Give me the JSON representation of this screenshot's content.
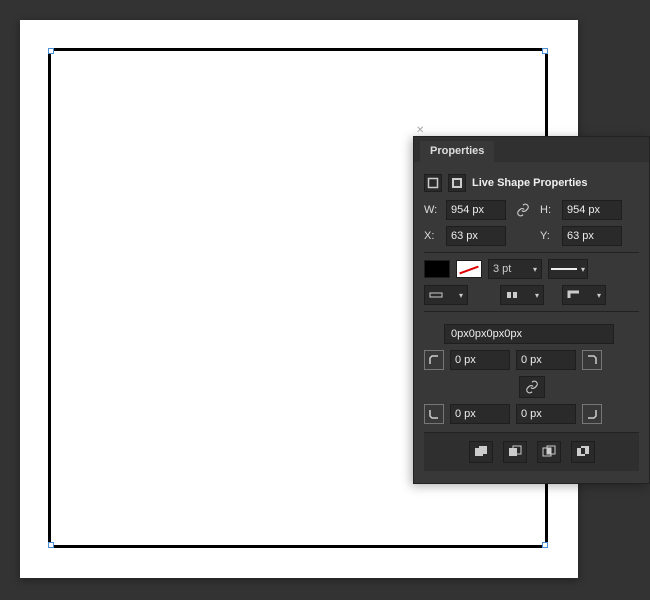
{
  "panel": {
    "tab_label": "Properties",
    "section_title": "Live Shape Properties",
    "width_label": "W:",
    "height_label": "H:",
    "x_label": "X:",
    "y_label": "Y:",
    "width_value": "954 px",
    "height_value": "954 px",
    "x_value": "63 px",
    "y_value": "63 px",
    "stroke_weight": "3 pt",
    "corner_summary": "0px0px0px0px",
    "corners": {
      "tl": "0 px",
      "tr": "0 px",
      "bl": "0 px",
      "br": "0 px"
    },
    "fill_color": "#000000",
    "stroke_style": "solid"
  }
}
